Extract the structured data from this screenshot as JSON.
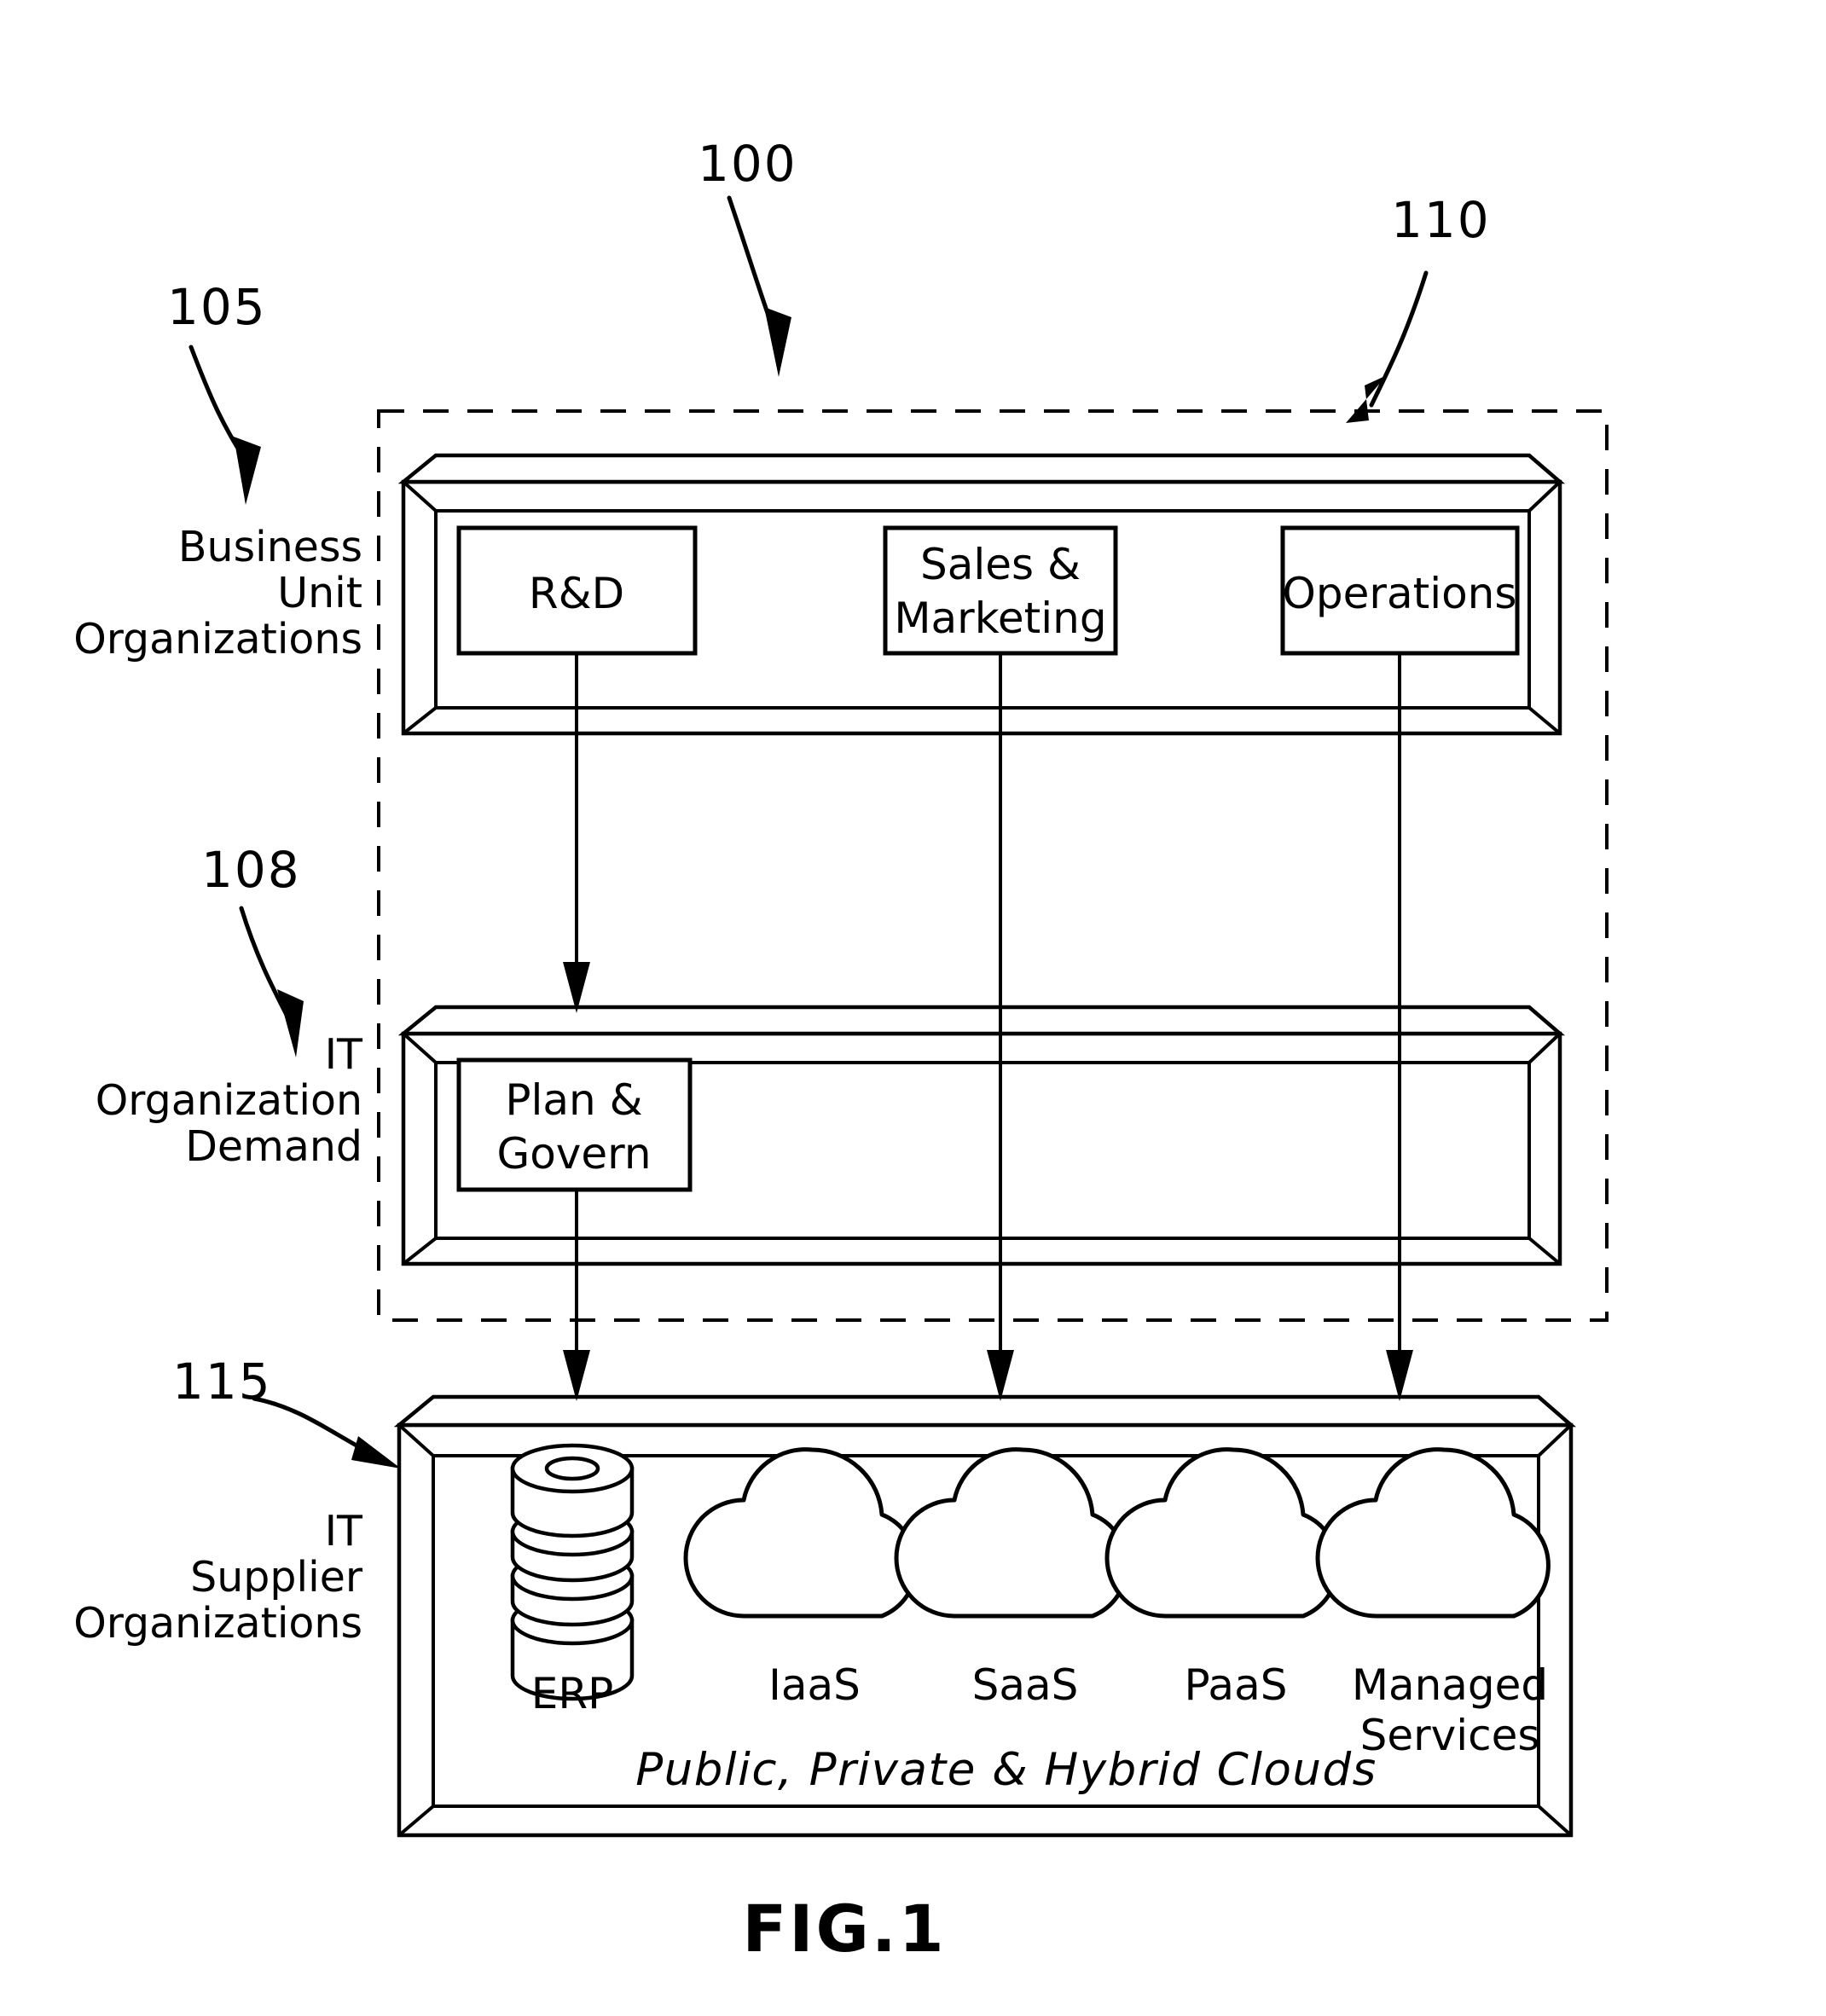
{
  "figure": {
    "caption": "FIG.1",
    "reference_numerals": {
      "system": "100",
      "business_unit": "105",
      "enterprise_boundary": "110",
      "it_demand": "108",
      "it_supplier": "115"
    }
  },
  "side_labels": {
    "business_unit": [
      "Business",
      "Unit",
      "Organizations"
    ],
    "it_demand": [
      "IT",
      "Organization",
      "Demand"
    ],
    "it_supplier": [
      "IT",
      "Supplier",
      "Organizations"
    ]
  },
  "business_unit_layer": {
    "boxes": [
      {
        "id": "rd",
        "lines": [
          "R&D"
        ]
      },
      {
        "id": "sales-marketing",
        "lines": [
          "Sales  &",
          "Marketing"
        ]
      },
      {
        "id": "operations",
        "lines": [
          "Operations"
        ]
      }
    ]
  },
  "it_demand_layer": {
    "boxes": [
      {
        "id": "plan-govern",
        "lines": [
          "Plan  &",
          "Govern"
        ]
      }
    ]
  },
  "it_supplier_layer": {
    "footer_text": "Public,  Private  &  Hybrid  Clouds",
    "nodes": [
      {
        "id": "erp",
        "icon": "database-icon",
        "lines": [
          "ERP"
        ]
      },
      {
        "id": "iaas",
        "icon": "cloud-icon",
        "lines": [
          "IaaS"
        ]
      },
      {
        "id": "saas",
        "icon": "cloud-icon",
        "lines": [
          "SaaS"
        ]
      },
      {
        "id": "paas",
        "icon": "cloud-icon",
        "lines": [
          "PaaS"
        ]
      },
      {
        "id": "managed-services",
        "icon": "cloud-icon",
        "lines": [
          "Managed",
          "Services"
        ]
      }
    ]
  },
  "colors": {
    "line": "#000000",
    "background": "#ffffff"
  }
}
